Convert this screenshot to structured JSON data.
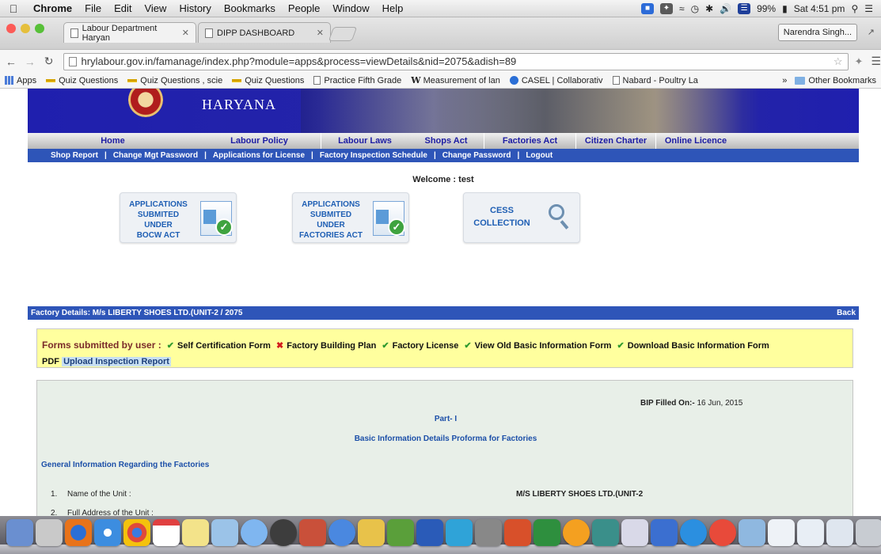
{
  "menubar": {
    "app": "Chrome",
    "menus": [
      "File",
      "Edit",
      "View",
      "History",
      "Bookmarks",
      "People",
      "Window",
      "Help"
    ],
    "battery": "99%",
    "clock": "Sat 4:51 pm"
  },
  "tabs": [
    {
      "title": "Labour Department Haryan"
    },
    {
      "title": "DIPP DASHBOARD"
    }
  ],
  "profile": "Narendra Singh...",
  "address": {
    "url": "hrylabour.gov.in/famanage/index.php?module=apps&process=viewDetails&nid=2075&adish=89"
  },
  "bookmarks": {
    "items": [
      "Apps",
      "Quiz Questions",
      "Quiz Questions , scie",
      "Quiz Questions",
      "Practice Fifth Grade",
      "Measurement of lan",
      "CASEL | Collaborativ",
      "Nabard - Poultry La"
    ],
    "overflow": "»",
    "other": "Other Bookmarks"
  },
  "banner": {
    "title": "HARYANA"
  },
  "mainnav": [
    "Home",
    "Labour Policy",
    "Labour Laws",
    "Shops Act",
    "Factories Act",
    "Citizen Charter",
    "Online Licence"
  ],
  "subnav": [
    "Shop Report",
    "Change Mgt Password",
    "Applications for License",
    "Factory Inspection Schedule",
    "Change Password",
    "Logout"
  ],
  "welcome": "Welcome : test",
  "tiles": [
    {
      "line1": "APPLICATIONS SUBMITED",
      "line2": "UNDER",
      "line3": "BOCW ACT"
    },
    {
      "line1": "APPLICATIONS SUBMITED",
      "line2": "UNDER",
      "line3": "FACTORIES ACT"
    },
    {
      "line1": "CESS",
      "line2": "COLLECTION"
    }
  ],
  "factory": {
    "title": "Factory Details: M/s LIBERTY SHOES LTD.(UNIT-2 / 2075",
    "back": "Back"
  },
  "forms": {
    "label": "Forms submitted by user :",
    "items": [
      "Self Certification Form",
      "Factory Building Plan",
      "Factory License",
      "View Old Basic Information Form",
      "Download Basic Information Form"
    ],
    "pdf": "PDF",
    "upload": "Upload Inspection Report"
  },
  "details": {
    "bip_label": "BIP Filled On:-",
    "bip_date": "16 Jun, 2015",
    "part": "Part- I",
    "proforma": "Basic Information Details Proforma for Factories",
    "section": "General Information Regarding the Factories",
    "rows": [
      {
        "num": "1.",
        "label": "Name of the Unit :",
        "value": "M/S LIBERTY SHOES LTD.(UNIT-2"
      },
      {
        "num": "2.",
        "label": "Full Address of the Unit :",
        "value": ""
      }
    ]
  }
}
